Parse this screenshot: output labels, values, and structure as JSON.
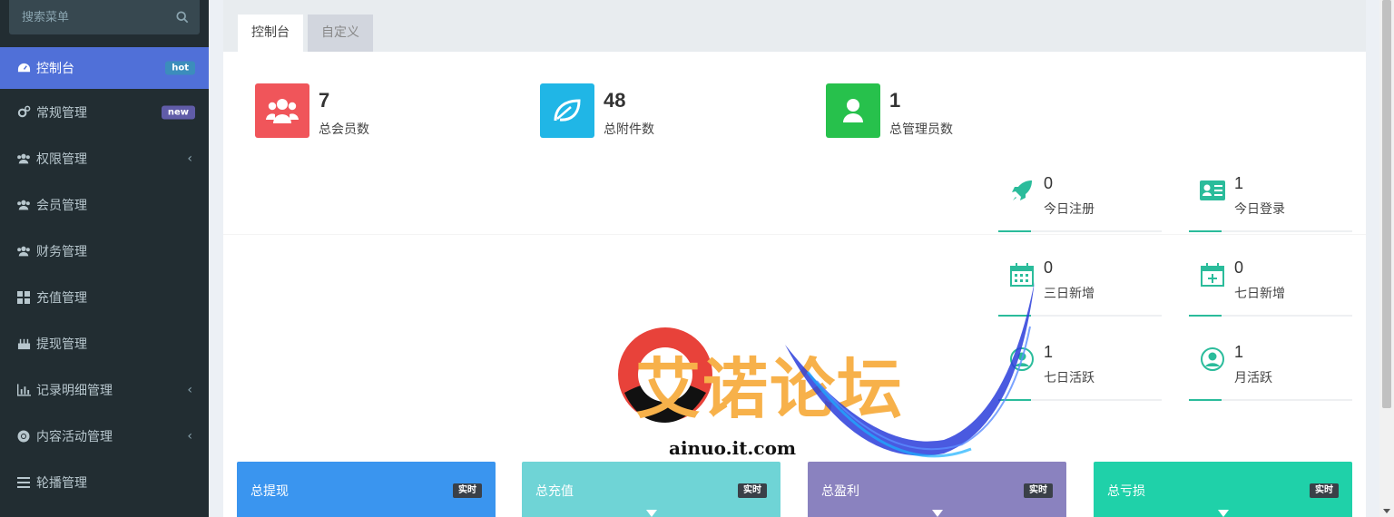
{
  "sidebar": {
    "search_placeholder": "搜索菜单",
    "items": [
      {
        "label": "控制台",
        "icon": "dashboard-icon",
        "badge": "hot",
        "badge_color": "#3c8dbc",
        "active": true
      },
      {
        "label": "常规管理",
        "icon": "cogs-icon",
        "badge": "new",
        "badge_color": "#605ca8"
      },
      {
        "label": "权限管理",
        "icon": "users-icon",
        "chevron": "‹"
      },
      {
        "label": "会员管理",
        "icon": "users-icon"
      },
      {
        "label": "财务管理",
        "icon": "users-icon"
      },
      {
        "label": "充值管理",
        "icon": "th-large-icon"
      },
      {
        "label": "提现管理",
        "icon": "birthday-cake-icon"
      },
      {
        "label": "记录明细管理",
        "icon": "bar-chart-icon",
        "chevron": "‹"
      },
      {
        "label": "内容活动管理",
        "icon": "chrome-icon",
        "chevron": "‹"
      },
      {
        "label": "轮播管理",
        "icon": "bars-icon"
      }
    ]
  },
  "tabs": [
    {
      "label": "控制台",
      "active": true
    },
    {
      "label": "自定义",
      "active": false
    }
  ],
  "stats": [
    {
      "value": "7",
      "label": "总会员数",
      "color": "#f0555a",
      "icon": "users-icon"
    },
    {
      "value": "48",
      "label": "总附件数",
      "color": "#20b6e6",
      "icon": "leaf-icon"
    },
    {
      "value": "1",
      "label": "总管理员数",
      "color": "#27c14c",
      "icon": "user-icon"
    }
  ],
  "mini_stats": [
    {
      "value": "0",
      "label": "今日注册",
      "icon": "rocket-icon"
    },
    {
      "value": "1",
      "label": "今日登录",
      "icon": "vcard-icon"
    },
    {
      "value": "0",
      "label": "三日新增",
      "icon": "calendar-icon"
    },
    {
      "value": "0",
      "label": "七日新增",
      "icon": "calendar-plus-icon"
    },
    {
      "value": "1",
      "label": "七日活跃",
      "icon": "user-circle-icon"
    },
    {
      "value": "1",
      "label": "月活跃",
      "icon": "user-circle-icon"
    }
  ],
  "accent_color": "#2bbc9b",
  "cards": [
    {
      "title": "总提现",
      "tag": "实时",
      "color": "#3a95ef"
    },
    {
      "title": "总充值",
      "tag": "实时",
      "color": "#6fd4d6"
    },
    {
      "title": "总盈利",
      "tag": "实时",
      "color": "#8a82bf"
    },
    {
      "title": "总亏损",
      "tag": "实时",
      "color": "#1fd1a9"
    }
  ],
  "watermark": {
    "text": "艾诺论坛",
    "url": "ainuo.it.com"
  }
}
